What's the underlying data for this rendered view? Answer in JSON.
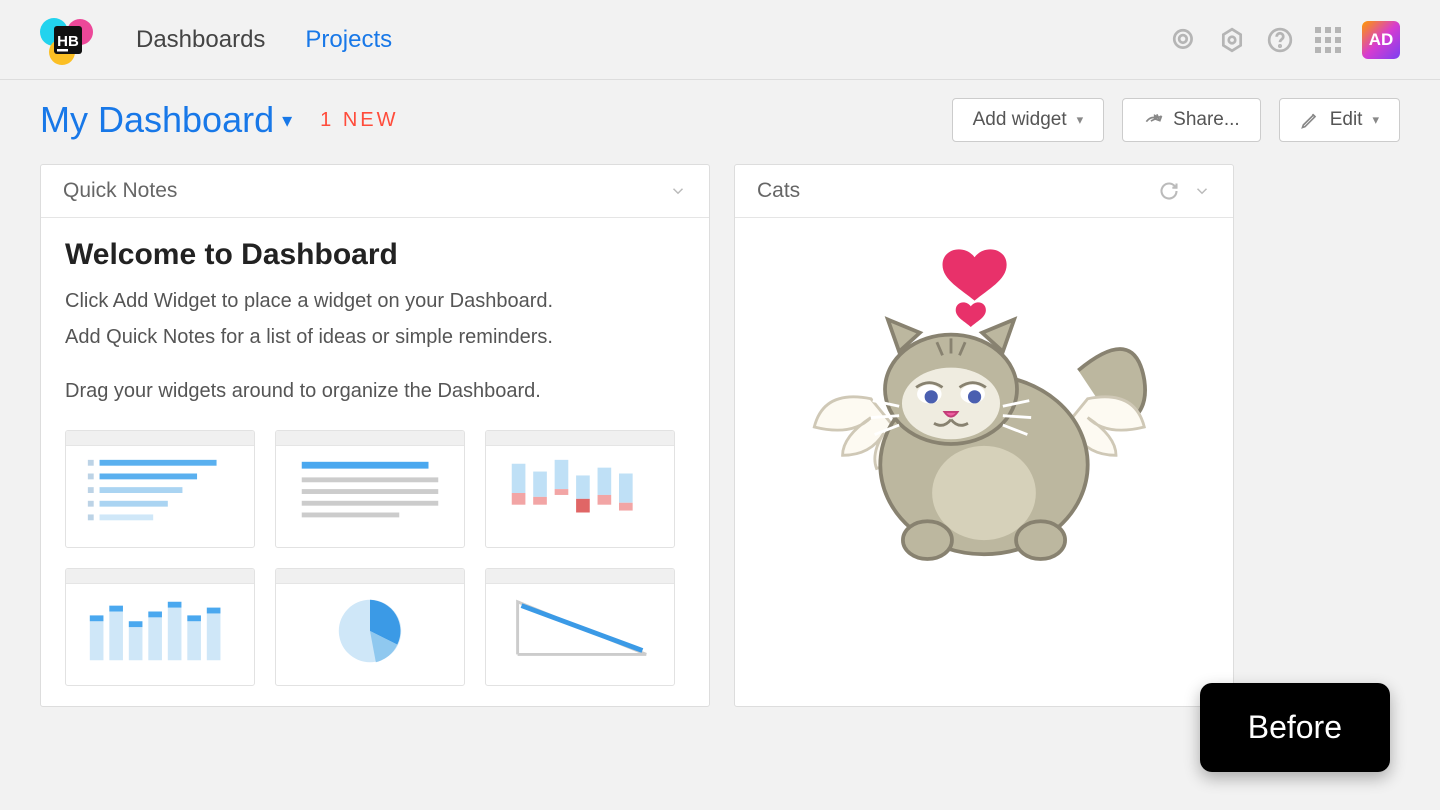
{
  "nav": {
    "dashboards": "Dashboards",
    "projects": "Projects"
  },
  "avatar": "AD",
  "subheader": {
    "title": "My Dashboard",
    "new_badge": "1 NEW"
  },
  "actions": {
    "add_widget": "Add widget",
    "share": "Share...",
    "edit": "Edit"
  },
  "widgets": {
    "quick_notes": {
      "title": "Quick Notes",
      "heading": "Welcome to Dashboard",
      "line1": "Click Add Widget to place a widget on your Dashboard.",
      "line2": "Add Quick Notes for a list of ideas or simple reminders.",
      "line3": "Drag your widgets around to organize the Dashboard."
    },
    "cats": {
      "title": "Cats"
    }
  },
  "overlay": {
    "before": "Before"
  }
}
